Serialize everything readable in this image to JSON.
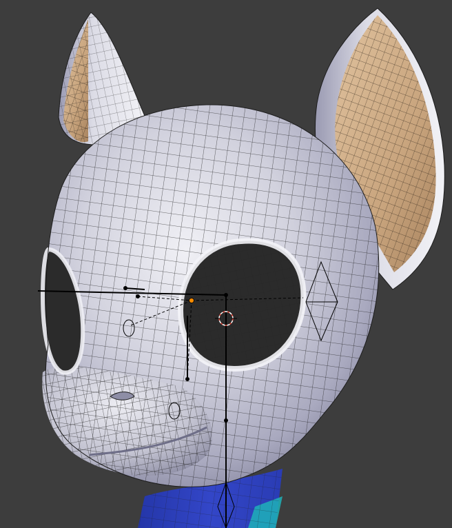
{
  "viewport": {
    "background": "#3d3d3d",
    "colors": {
      "head_fill": "#c9c9d6",
      "head_light": "#eeeef3",
      "head_shadow": "#8f8fa8",
      "wire": "#1c1c1c",
      "inner_ear": "#c9a57e",
      "inner_ear_light": "#d8b791",
      "neck_blue": "#2e3fbf",
      "neck_cyan": "#1eb1b8",
      "rig_line": "#000000",
      "selected_bone": "#ff8c00",
      "cursor_red": "#e84b3c"
    },
    "objects": [
      "pony-head-mesh",
      "left-ear",
      "right-ear",
      "armature-bones",
      "3d-cursor",
      "neck-mesh"
    ]
  }
}
